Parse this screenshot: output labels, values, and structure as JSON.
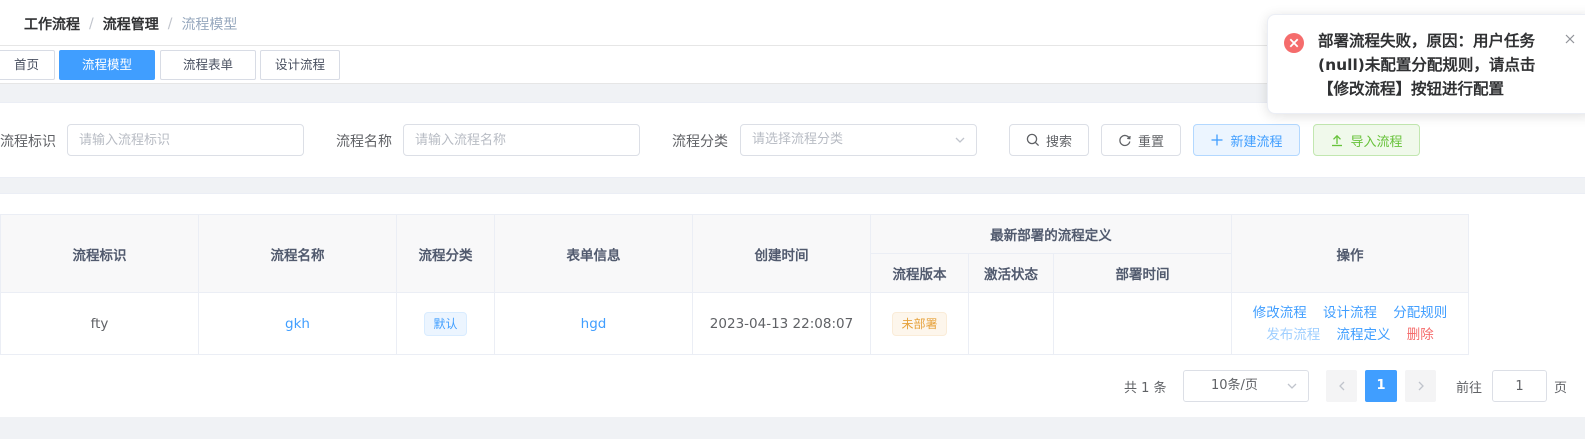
{
  "breadcrumb": [
    "工作流程",
    "流程管理",
    "流程模型"
  ],
  "breadcrumb_sep": "/",
  "tags": [
    "首页",
    "流程模型",
    "流程表单",
    "设计流程"
  ],
  "search": {
    "key_label": "流程标识",
    "key_placeholder": "请输入流程标识",
    "name_label": "流程名称",
    "name_placeholder": "请输入流程名称",
    "category_label": "流程分类",
    "category_placeholder": "请选择流程分类",
    "search_button": "搜索",
    "reset_button": "重置",
    "create_button": "新建流程",
    "import_button": "导入流程"
  },
  "table": {
    "headers": {
      "key": "流程标识",
      "name": "流程名称",
      "category": "流程分类",
      "form": "表单信息",
      "created": "创建时间",
      "latest_group": "最新部署的流程定义",
      "version": "流程版本",
      "active": "激活状态",
      "deploy_time": "部署时间",
      "actions": "操作"
    },
    "rows": [
      {
        "key": "fty",
        "name": "gkh",
        "category": "默认",
        "form": "hgd",
        "created": "2023-04-13 22:08:07",
        "version": "未部署",
        "active": "",
        "deploy_time": "",
        "actions": [
          "修改流程",
          "设计流程",
          "分配规则",
          "发布流程",
          "流程定义",
          "删除"
        ]
      }
    ]
  },
  "pagination": {
    "total": "共 1 条",
    "page_size": "10条/页",
    "current": "1",
    "goto_label": "前往",
    "goto_value": "1",
    "page_suffix": "页"
  },
  "toast": {
    "message": "部署流程失败，原因：用户任务(null)未配置分配规则，请点击【修改流程】按钮进行配置"
  },
  "colors": {
    "primary": "#409eff",
    "success": "#67c23a",
    "warning": "#e6a23c",
    "danger": "#f56c6c"
  }
}
